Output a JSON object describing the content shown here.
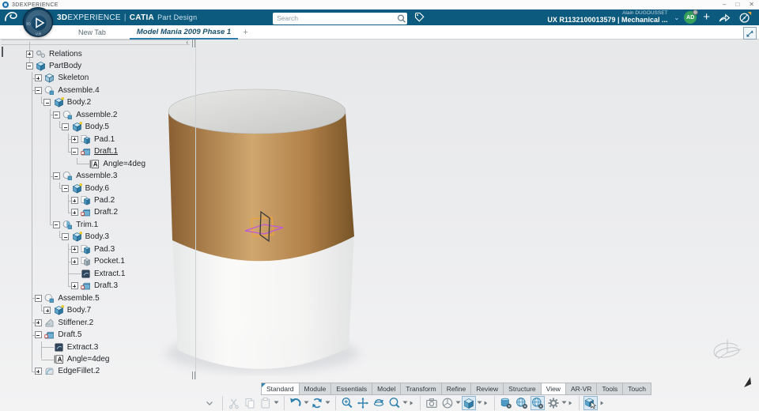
{
  "window": {
    "title": "3DEXPERIENCE",
    "minimize": "–",
    "maximize": "□",
    "close": "✕"
  },
  "appbar": {
    "brand_bold": "3D",
    "brand_rest": "EXPERIENCE",
    "divider": "|",
    "app_name": "CATIA",
    "module_name": "Part Design",
    "search_placeholder": "Search",
    "user_name": "Alain DUGOUSSET",
    "workspace": "UX R1132100013579 | Mechanical ...",
    "avatar_initials": "AD",
    "add_label": "+",
    "bar_color": "#0d5a7f"
  },
  "doc_tabs": {
    "new_tab": "New Tab",
    "active_tab": "Model Mania 2009 Phase 1",
    "add": "+"
  },
  "tree": {
    "nodes": [
      {
        "label": "Relations",
        "level": 0,
        "expander": "plus",
        "icon": "relations"
      },
      {
        "label": "PartBody",
        "level": 0,
        "expander": "minus",
        "icon": "partbody"
      },
      {
        "label": "Skeleton",
        "level": 1,
        "expander": "plus",
        "icon": "skeleton"
      },
      {
        "label": "Assemble.4",
        "level": 1,
        "expander": "minus",
        "icon": "assemble"
      },
      {
        "label": "Body.2",
        "level": 2,
        "expander": "minus",
        "icon": "body"
      },
      {
        "label": "Assemble.2",
        "level": 3,
        "expander": "minus",
        "icon": "assemble"
      },
      {
        "label": "Body.5",
        "level": 4,
        "expander": "minus",
        "icon": "body"
      },
      {
        "label": "Pad.1",
        "level": 5,
        "expander": "plus",
        "icon": "pad"
      },
      {
        "label": "Draft.1",
        "level": 5,
        "expander": "minus",
        "icon": "draft",
        "underline": true
      },
      {
        "label": "Angle=4deg",
        "level": 6,
        "expander": null,
        "icon": "angle"
      },
      {
        "label": "Assemble.3",
        "level": 3,
        "expander": "minus",
        "icon": "assemble"
      },
      {
        "label": "Body.6",
        "level": 4,
        "expander": "minus",
        "icon": "body"
      },
      {
        "label": "Pad.2",
        "level": 5,
        "expander": "plus",
        "icon": "pad"
      },
      {
        "label": "Draft.2",
        "level": 5,
        "expander": "plus",
        "icon": "draft"
      },
      {
        "label": "Trim.1",
        "level": 3,
        "expander": "minus",
        "icon": "trim"
      },
      {
        "label": "Body.3",
        "level": 4,
        "expander": "minus",
        "icon": "body"
      },
      {
        "label": "Pad.3",
        "level": 5,
        "expander": "plus",
        "icon": "pad"
      },
      {
        "label": "Pocket.1",
        "level": 5,
        "expander": "plus",
        "icon": "pocket"
      },
      {
        "label": "Extract.1",
        "level": 5,
        "expander": null,
        "icon": "extract"
      },
      {
        "label": "Draft.3",
        "level": 5,
        "expander": "plus",
        "icon": "draft"
      },
      {
        "label": "Assemble.5",
        "level": 1,
        "expander": "minus",
        "icon": "assemble"
      },
      {
        "label": "Body.7",
        "level": 2,
        "expander": "plus",
        "icon": "body"
      },
      {
        "label": "Stiffener.2",
        "level": 1,
        "expander": "plus",
        "icon": "stiffener"
      },
      {
        "label": "Draft.5",
        "level": 1,
        "expander": "minus",
        "icon": "draft"
      },
      {
        "label": "Extract.3",
        "level": 2,
        "expander": null,
        "icon": "extract"
      },
      {
        "label": "Angle=4deg",
        "level": 2,
        "expander": null,
        "icon": "angle"
      },
      {
        "label": "EdgeFillet.2",
        "level": 1,
        "expander": "plus",
        "icon": "edgefillet"
      }
    ]
  },
  "action_tabs": {
    "items": [
      {
        "label": "Standard",
        "active": true,
        "marker": true
      },
      {
        "label": "Module",
        "active": false
      },
      {
        "label": "Essentials",
        "active": false
      },
      {
        "label": "Model",
        "active": false
      },
      {
        "label": "Transform",
        "active": false
      },
      {
        "label": "Refine",
        "active": false
      },
      {
        "label": "Review",
        "active": false
      },
      {
        "label": "Structure",
        "active": false
      },
      {
        "label": "View",
        "active": true
      },
      {
        "label": "AR-VR",
        "active": false
      },
      {
        "label": "Tools",
        "active": false
      },
      {
        "label": "Touch",
        "active": false
      }
    ]
  },
  "toolbar": {
    "groups": [
      {
        "items": [
          {
            "icon": "chevron-down",
            "state": "muted"
          }
        ]
      },
      {
        "items": [
          {
            "icon": "cut",
            "state": "disabled"
          },
          {
            "icon": "copy",
            "state": "disabled"
          },
          {
            "icon": "paste",
            "state": "disabled",
            "caret": true
          }
        ]
      },
      {
        "items": [
          {
            "icon": "undo",
            "state": "blue",
            "caret": true
          },
          {
            "icon": "update",
            "state": "blue",
            "caret": true
          }
        ]
      },
      {
        "items": [
          {
            "icon": "zoom",
            "state": "blue"
          },
          {
            "icon": "pan",
            "state": "blue"
          },
          {
            "icon": "rotate",
            "state": "blue"
          },
          {
            "icon": "zoom-area",
            "state": "blue",
            "caret": true
          },
          {
            "icon": "overflow",
            "state": "muted"
          }
        ]
      },
      {
        "items": [
          {
            "icon": "capture",
            "state": "gray"
          },
          {
            "icon": "iso-view",
            "state": "gray",
            "caret": true
          },
          {
            "icon": "view-cube",
            "state": "blue",
            "selected": true,
            "caret": true
          },
          {
            "icon": "overflow",
            "state": "muted"
          }
        ]
      },
      {
        "items": [
          {
            "icon": "session-gear",
            "state": "blue"
          },
          {
            "icon": "globe-gear",
            "state": "blue"
          },
          {
            "icon": "globe-gear",
            "state": "blue",
            "selected": true
          },
          {
            "icon": "gear",
            "state": "gray",
            "caret": true
          },
          {
            "icon": "overflow",
            "state": "muted"
          }
        ]
      },
      {
        "items": [
          {
            "icon": "select-cube",
            "state": "blue",
            "selected": true
          },
          {
            "icon": "overflow",
            "state": "muted"
          }
        ]
      }
    ]
  },
  "viewport": {
    "colors": {
      "copper_dark": "#8a6034",
      "copper_mid": "#a87c49",
      "copper_light": "#cfa76f",
      "copper_shadow": "#775427",
      "top_face_light": "#e8e9e7",
      "top_face_dark": "#c6c7c5",
      "marker_orange": "#eda43b",
      "marker_magenta": "#c158d8",
      "marker_dark": "#3a3a3a"
    }
  }
}
